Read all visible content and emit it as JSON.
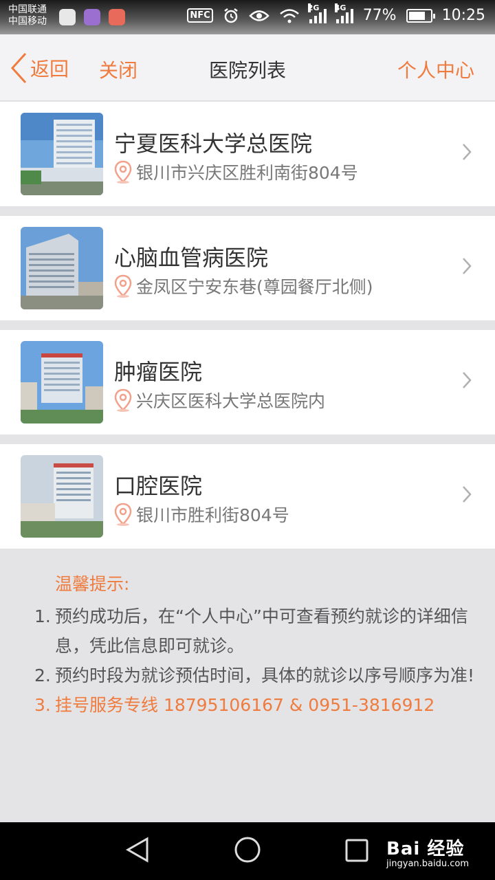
{
  "status_bar": {
    "carrier_1": "中国联通",
    "carrier_2": "中国移动",
    "nfc": "NFC",
    "net_1": "2G",
    "net_2": "4G",
    "battery": "77%",
    "time": "10:25"
  },
  "nav": {
    "back_label": "返回",
    "close_label": "关闭",
    "title": "医院列表",
    "profile_label": "个人中心"
  },
  "hospitals": [
    {
      "name": "宁夏医科大学总医院",
      "address": "银川市兴庆区胜利南街804号"
    },
    {
      "name": "心脑血管病医院",
      "address": "金凤区宁安东巷(尊园餐厅北侧)"
    },
    {
      "name": "肿瘤医院",
      "address": "兴庆区医科大学总医院内"
    },
    {
      "name": "口腔医院",
      "address": "银川市胜利街804号"
    }
  ],
  "tips": {
    "title": "温馨提示:",
    "items": [
      {
        "num": "1.",
        "text": "预约成功后，在“个人中心”中可查看预约就诊的详细信息，凭此信息即可就诊。"
      },
      {
        "num": "2.",
        "text": "预约时段为就诊预估时间，具体的就诊以序号顺序为准!"
      },
      {
        "num": "3.",
        "text": "挂号服务专线 18795106167 & 0951-3816912"
      }
    ]
  },
  "watermark": {
    "logo": "Bai 经验",
    "url": "jingyan.baidu.com"
  },
  "colors": {
    "accent": "#ef7b3e",
    "background": "#e4e4e6"
  }
}
